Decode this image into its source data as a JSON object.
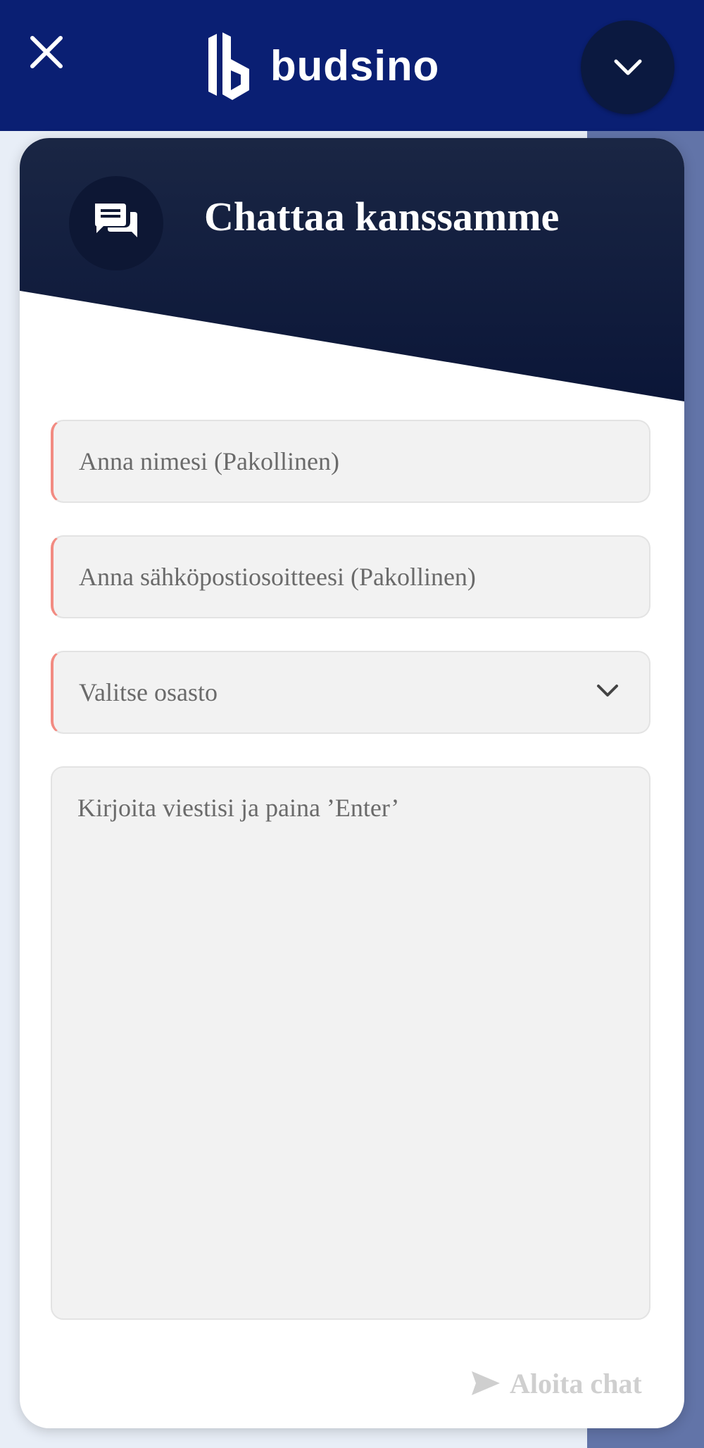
{
  "site": {
    "logo_text": "budsino"
  },
  "widget": {
    "title": "Chattaa kanssamme",
    "name_placeholder": "Anna nimesi (Pakollinen)",
    "email_placeholder": "Anna sähköpostiosoitteesi (Pakollinen)",
    "department_value": "Valitse osasto",
    "message_placeholder": "Kirjoita viestisi ja paina ’Enter’",
    "start_chat_label": "Aloita chat"
  },
  "colors": {
    "site_header": "#0a1f73",
    "widget_header": "#0b1638",
    "required_marker": "#f28b82",
    "disabled_text": "#cfcfcf"
  },
  "icons": [
    "close-icon",
    "budsino-logo-icon",
    "chevron-down-icon",
    "chat-bubbles-icon",
    "send-icon",
    "search-icon"
  ]
}
